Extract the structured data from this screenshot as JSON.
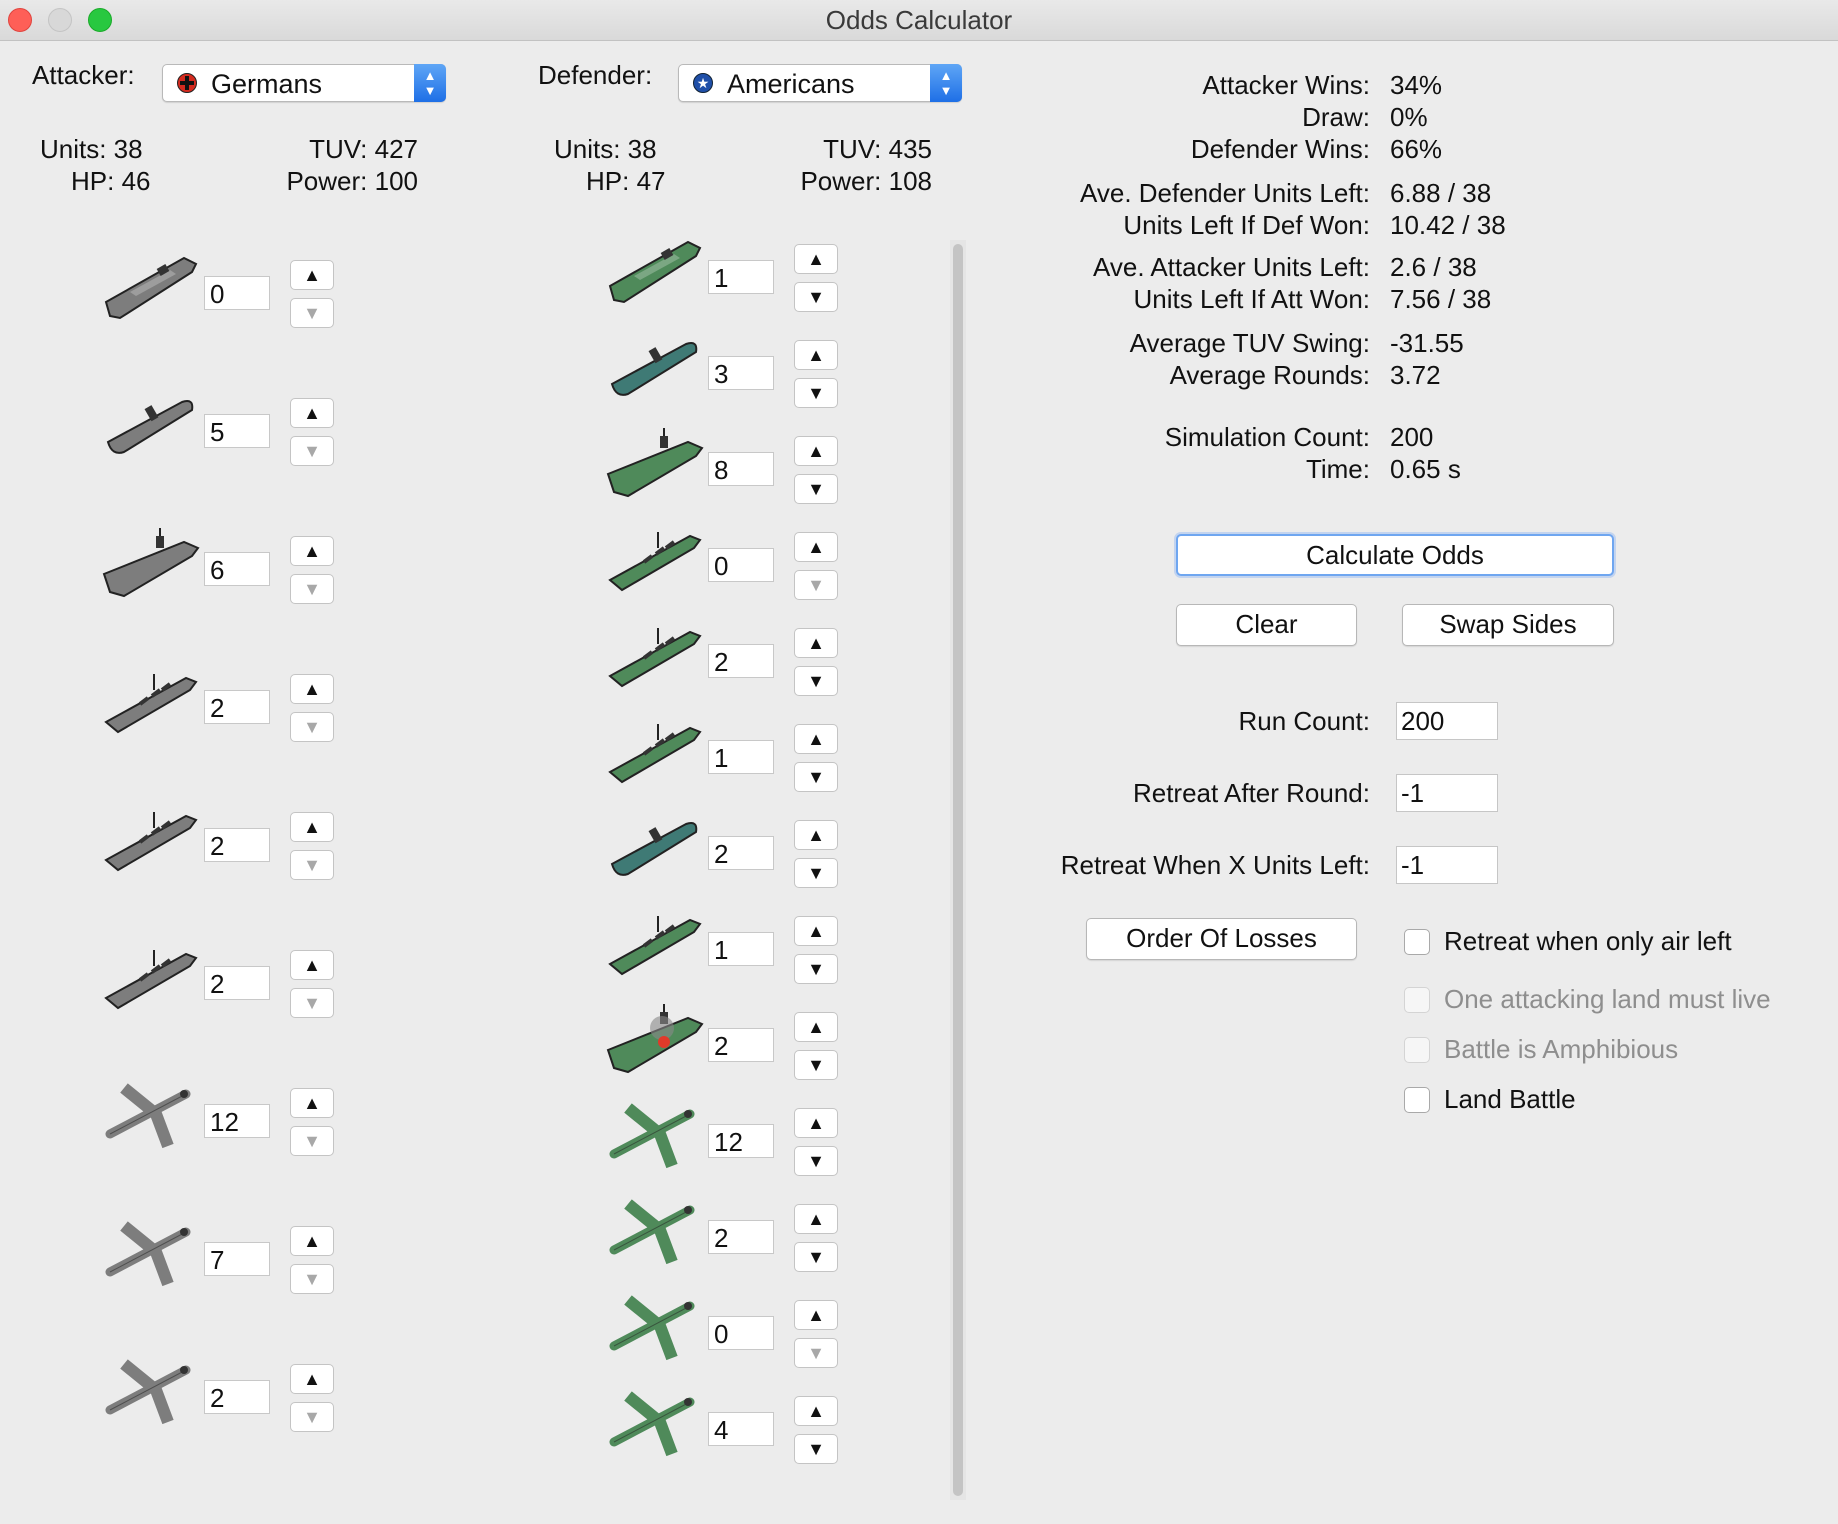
{
  "window": {
    "title": "Odds Calculator"
  },
  "attacker": {
    "label": "Attacker:",
    "nation": "Germans",
    "units_label": "Units: 38",
    "hp_label": "HP: 46",
    "tuv_label": "TUV: 427",
    "power_label": "Power: 100",
    "units": [
      {
        "icon": "transport-ship-icon",
        "count": "0",
        "up_enabled": true,
        "down_enabled": false
      },
      {
        "icon": "submarine-icon",
        "count": "5",
        "up_enabled": true,
        "down_enabled": false
      },
      {
        "icon": "carrier-icon",
        "count": "6",
        "up_enabled": true,
        "down_enabled": false
      },
      {
        "icon": "destroyer-icon",
        "count": "2",
        "up_enabled": true,
        "down_enabled": false
      },
      {
        "icon": "cruiser-icon",
        "count": "2",
        "up_enabled": true,
        "down_enabled": false
      },
      {
        "icon": "battleship-icon",
        "count": "2",
        "up_enabled": true,
        "down_enabled": false
      },
      {
        "icon": "fighter-icon",
        "count": "12",
        "up_enabled": true,
        "down_enabled": false
      },
      {
        "icon": "tactical-bomber-icon",
        "count": "7",
        "up_enabled": true,
        "down_enabled": false
      },
      {
        "icon": "bomber-icon",
        "count": "2",
        "up_enabled": true,
        "down_enabled": false
      }
    ]
  },
  "defender": {
    "label": "Defender:",
    "nation": "Americans",
    "units_label": "Units: 38",
    "hp_label": "HP: 47",
    "tuv_label": "TUV: 435",
    "power_label": "Power: 108",
    "units": [
      {
        "icon": "transport-ship-icon",
        "count": "1",
        "up_enabled": true,
        "down_enabled": true
      },
      {
        "icon": "submarine-icon",
        "count": "3",
        "up_enabled": true,
        "down_enabled": true
      },
      {
        "icon": "carrier-icon",
        "count": "8",
        "up_enabled": true,
        "down_enabled": true
      },
      {
        "icon": "destroyer-icon",
        "count": "0",
        "up_enabled": true,
        "down_enabled": false
      },
      {
        "icon": "cruiser-icon",
        "count": "2",
        "up_enabled": true,
        "down_enabled": true
      },
      {
        "icon": "battleship-icon",
        "count": "1",
        "up_enabled": true,
        "down_enabled": true
      },
      {
        "icon": "submarine-icon",
        "count": "2",
        "up_enabled": true,
        "down_enabled": true
      },
      {
        "icon": "cruiser-icon",
        "count": "1",
        "up_enabled": true,
        "down_enabled": true
      },
      {
        "icon": "damaged-carrier-icon",
        "count": "2",
        "up_enabled": true,
        "down_enabled": true
      },
      {
        "icon": "fighter-icon",
        "count": "12",
        "up_enabled": true,
        "down_enabled": true
      },
      {
        "icon": "tactical-bomber-icon",
        "count": "2",
        "up_enabled": true,
        "down_enabled": true
      },
      {
        "icon": "bomber-icon",
        "count": "0",
        "up_enabled": true,
        "down_enabled": false
      },
      {
        "icon": "fighter-icon",
        "count": "4",
        "up_enabled": true,
        "down_enabled": true
      }
    ]
  },
  "results": [
    {
      "label": "Attacker Wins:",
      "value": "34%"
    },
    {
      "label": "Draw:",
      "value": "0%"
    },
    {
      "label": "Defender Wins:",
      "value": "66%"
    },
    {
      "label": "Ave. Defender Units Left:",
      "value": "6.88 / 38"
    },
    {
      "label": "Units Left If Def Won:",
      "value": "10.42 / 38"
    },
    {
      "label": "Ave. Attacker Units Left:",
      "value": "2.6 / 38"
    },
    {
      "label": "Units Left If Att Won:",
      "value": "7.56 / 38"
    },
    {
      "label": "Average TUV Swing:",
      "value": "-31.55"
    },
    {
      "label": "Average Rounds:",
      "value": "3.72"
    },
    {
      "label": "Simulation Count:",
      "value": "200"
    },
    {
      "label": "Time:",
      "value": "0.65 s"
    }
  ],
  "buttons": {
    "calculate": "Calculate Odds",
    "clear": "Clear",
    "swap": "Swap Sides",
    "order_of_losses": "Order Of Losses"
  },
  "settings": {
    "run_count_label": "Run Count:",
    "run_count_value": "200",
    "retreat_after_round_label": "Retreat After Round:",
    "retreat_after_round_value": "-1",
    "retreat_units_left_label": "Retreat When X Units Left:",
    "retreat_units_left_value": "-1"
  },
  "checkboxes": [
    {
      "label": "Retreat when only air left",
      "checked": false,
      "enabled": true
    },
    {
      "label": "One attacking land must live",
      "checked": false,
      "enabled": false
    },
    {
      "label": "Battle is Amphibious",
      "checked": false,
      "enabled": false
    },
    {
      "label": "Land Battle",
      "checked": false,
      "enabled": true
    }
  ],
  "colors": {
    "attacker_unit": "#7d7d7d",
    "defender_unit": "#4f8a5a",
    "defender_sub": "#3f7a75",
    "accent": "#2a78ea"
  }
}
